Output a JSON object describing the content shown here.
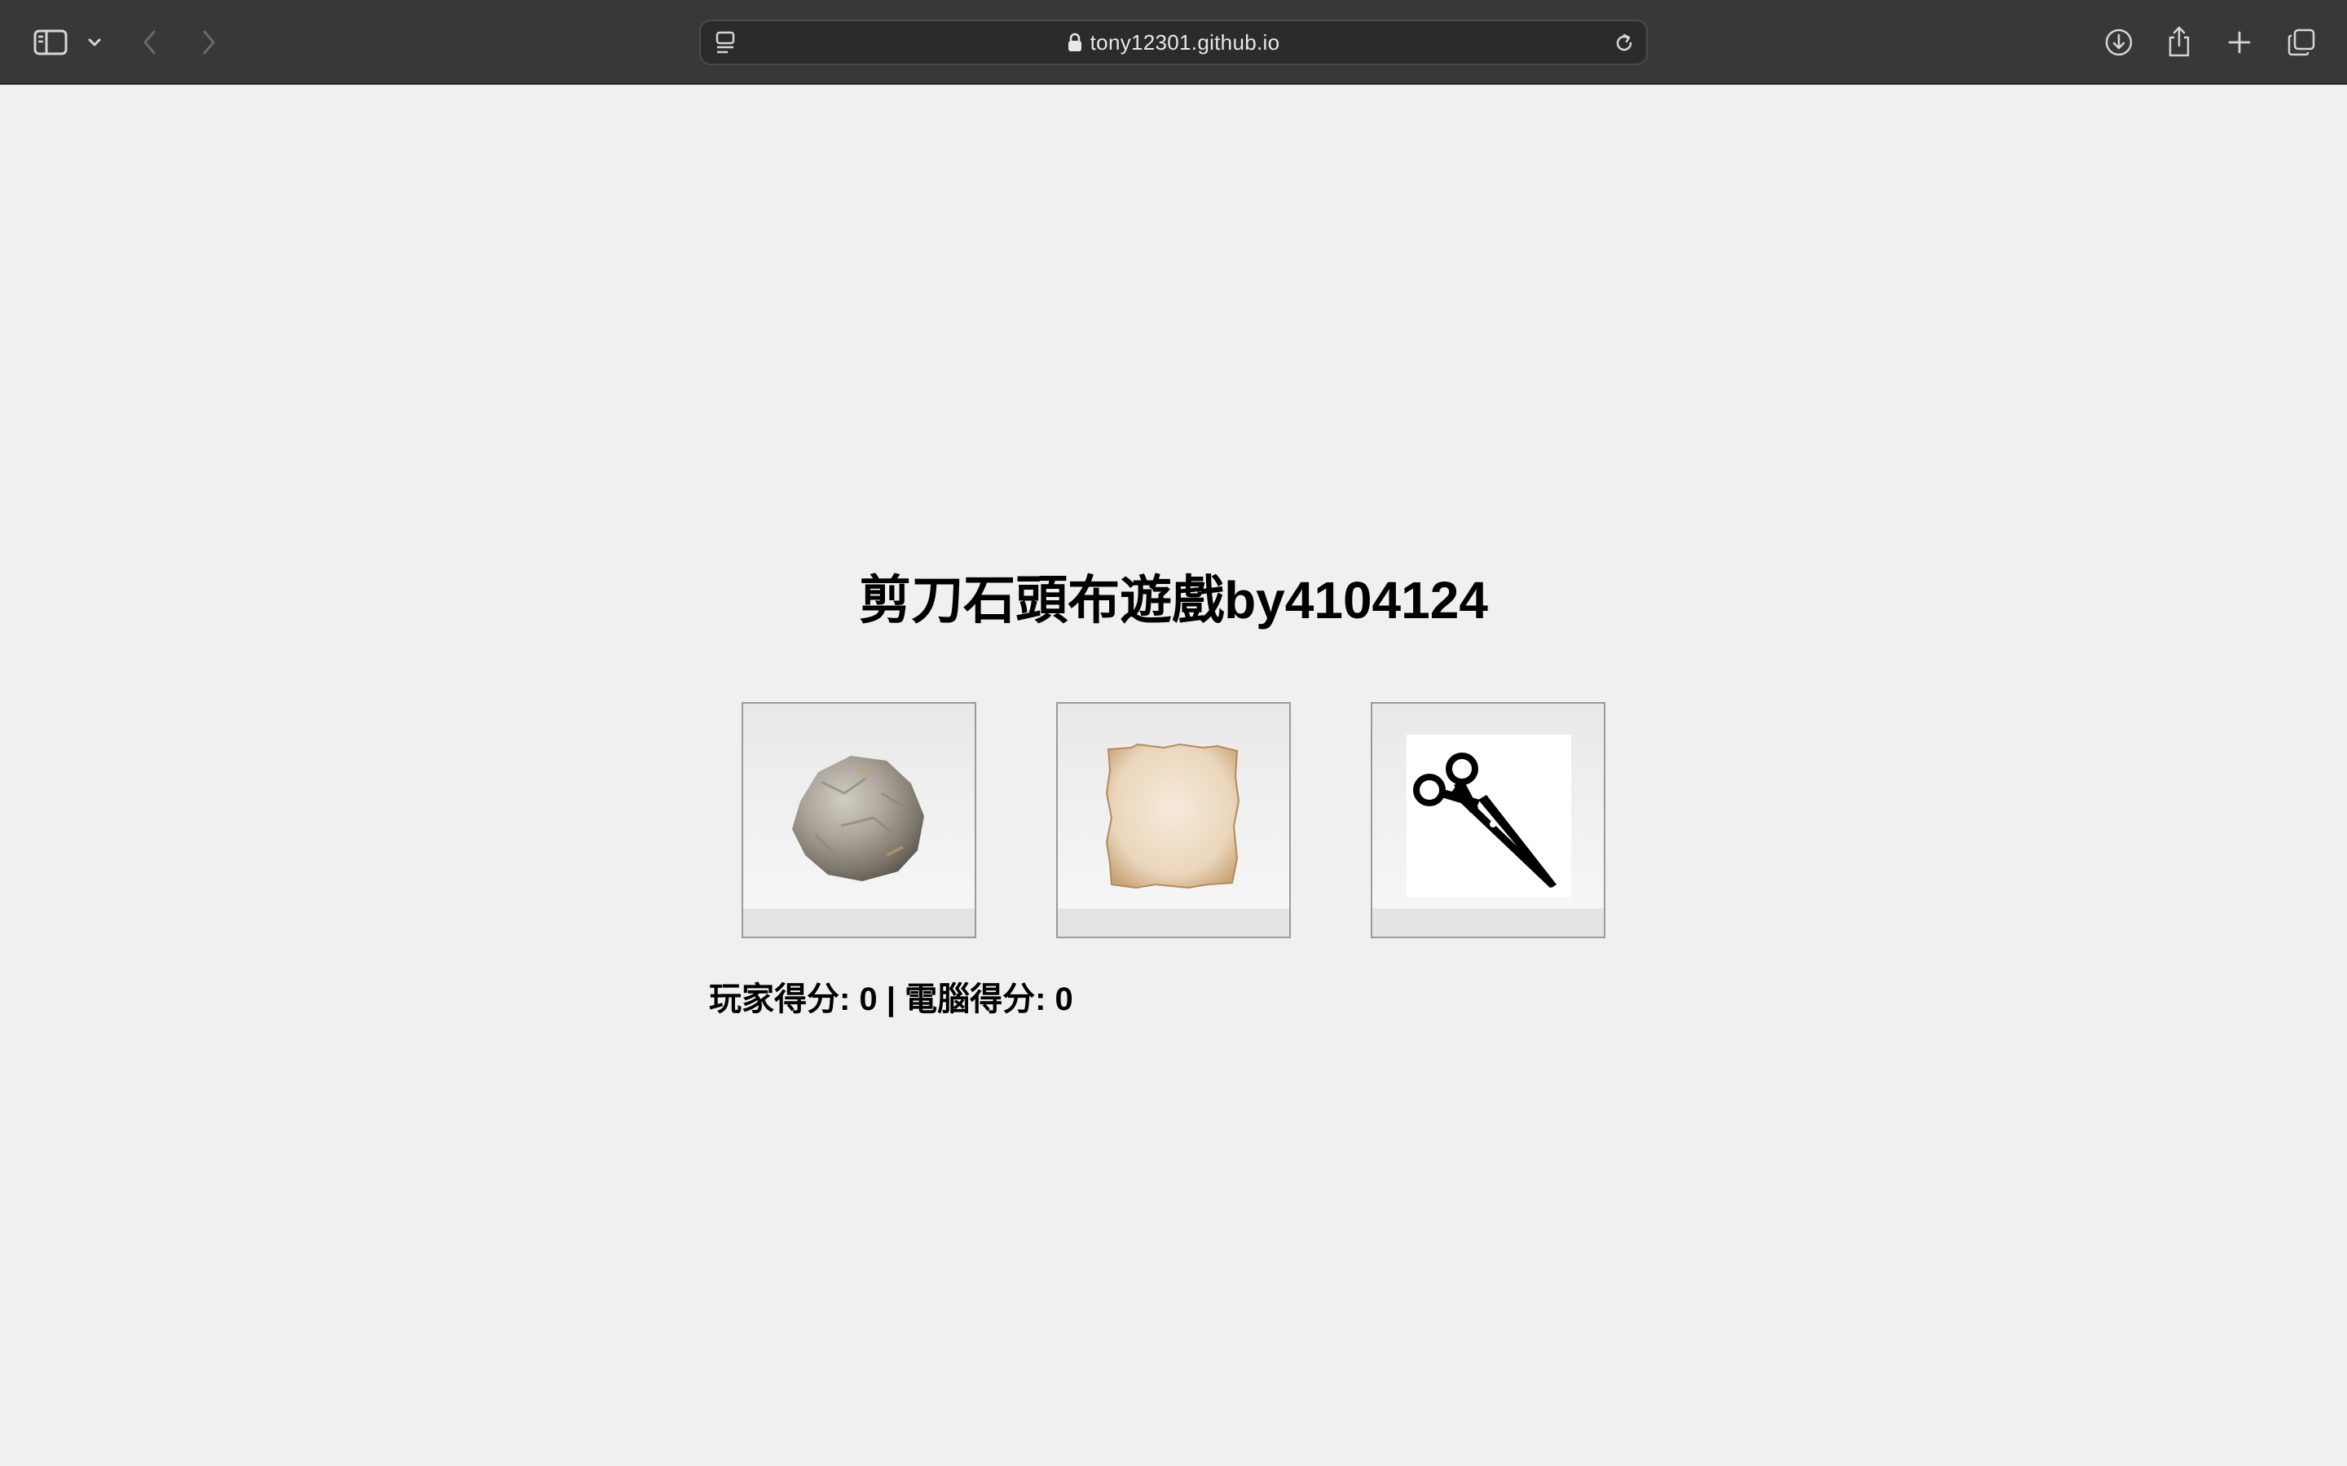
{
  "browser": {
    "url": "tony12301.github.io",
    "icons": {
      "sidebar": "sidebar-icon",
      "sidebar_menu": "chevron-down-icon",
      "back": "chevron-left-icon",
      "forward": "chevron-right-icon",
      "reader": "reader-icon",
      "lock": "lock-icon",
      "reload": "reload-icon",
      "downloads": "download-icon",
      "share": "share-icon",
      "new_tab": "plus-icon",
      "tabs": "tabs-overview-icon"
    }
  },
  "game": {
    "title": "剪刀石頭布遊戲by4104124",
    "choices": [
      {
        "name": "rock",
        "icon": "rock-icon"
      },
      {
        "name": "paper",
        "icon": "paper-icon"
      },
      {
        "name": "scissors",
        "icon": "scissors-icon"
      }
    ],
    "score_text": "玩家得分: 0 | 電腦得分: 0"
  }
}
